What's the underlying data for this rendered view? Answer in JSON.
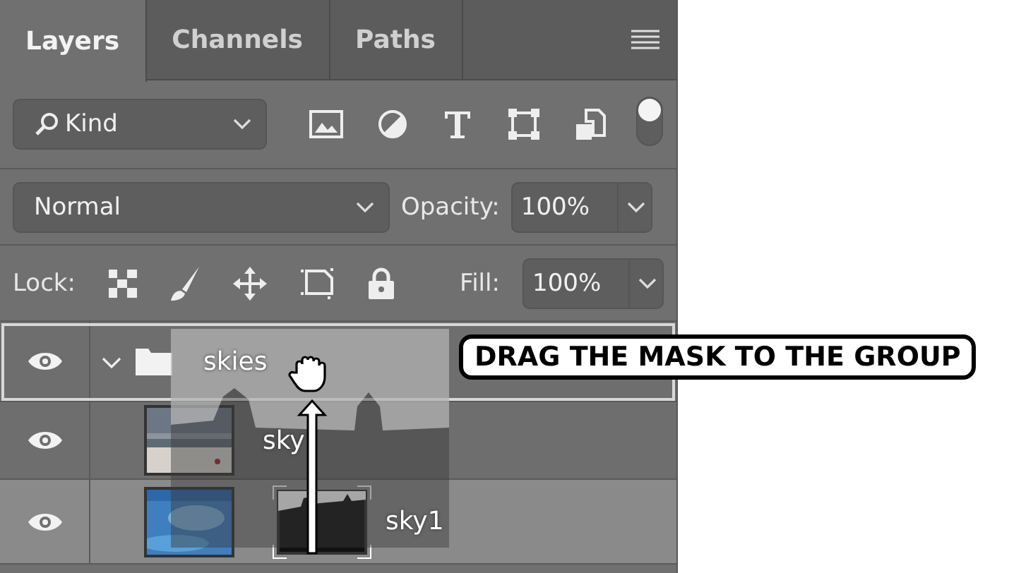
{
  "tabs": [
    {
      "label": "Layers",
      "selected": true
    },
    {
      "label": "Channels",
      "selected": false
    },
    {
      "label": "Paths",
      "selected": false
    }
  ],
  "filter": {
    "kind": "Kind",
    "on": true
  },
  "blend": {
    "mode": "Normal",
    "opacity_label": "Opacity:",
    "opacity": "100%"
  },
  "lock": {
    "label": "Lock:",
    "fill_label": "Fill:",
    "fill": "100%"
  },
  "layers": [
    {
      "kind": "group",
      "name": "skies",
      "visible": true,
      "expanded": true,
      "selected": false,
      "drop_target": true,
      "children": [
        {
          "kind": "layer",
          "name": "sky",
          "visible": true,
          "selected": false,
          "drop_target": false,
          "mask": false
        },
        {
          "kind": "layer",
          "name": "sky1",
          "visible": true,
          "selected": true,
          "drop_target": false,
          "mask": true
        }
      ]
    }
  ],
  "callout": "DRAG THE MASK TO THE GROUP"
}
